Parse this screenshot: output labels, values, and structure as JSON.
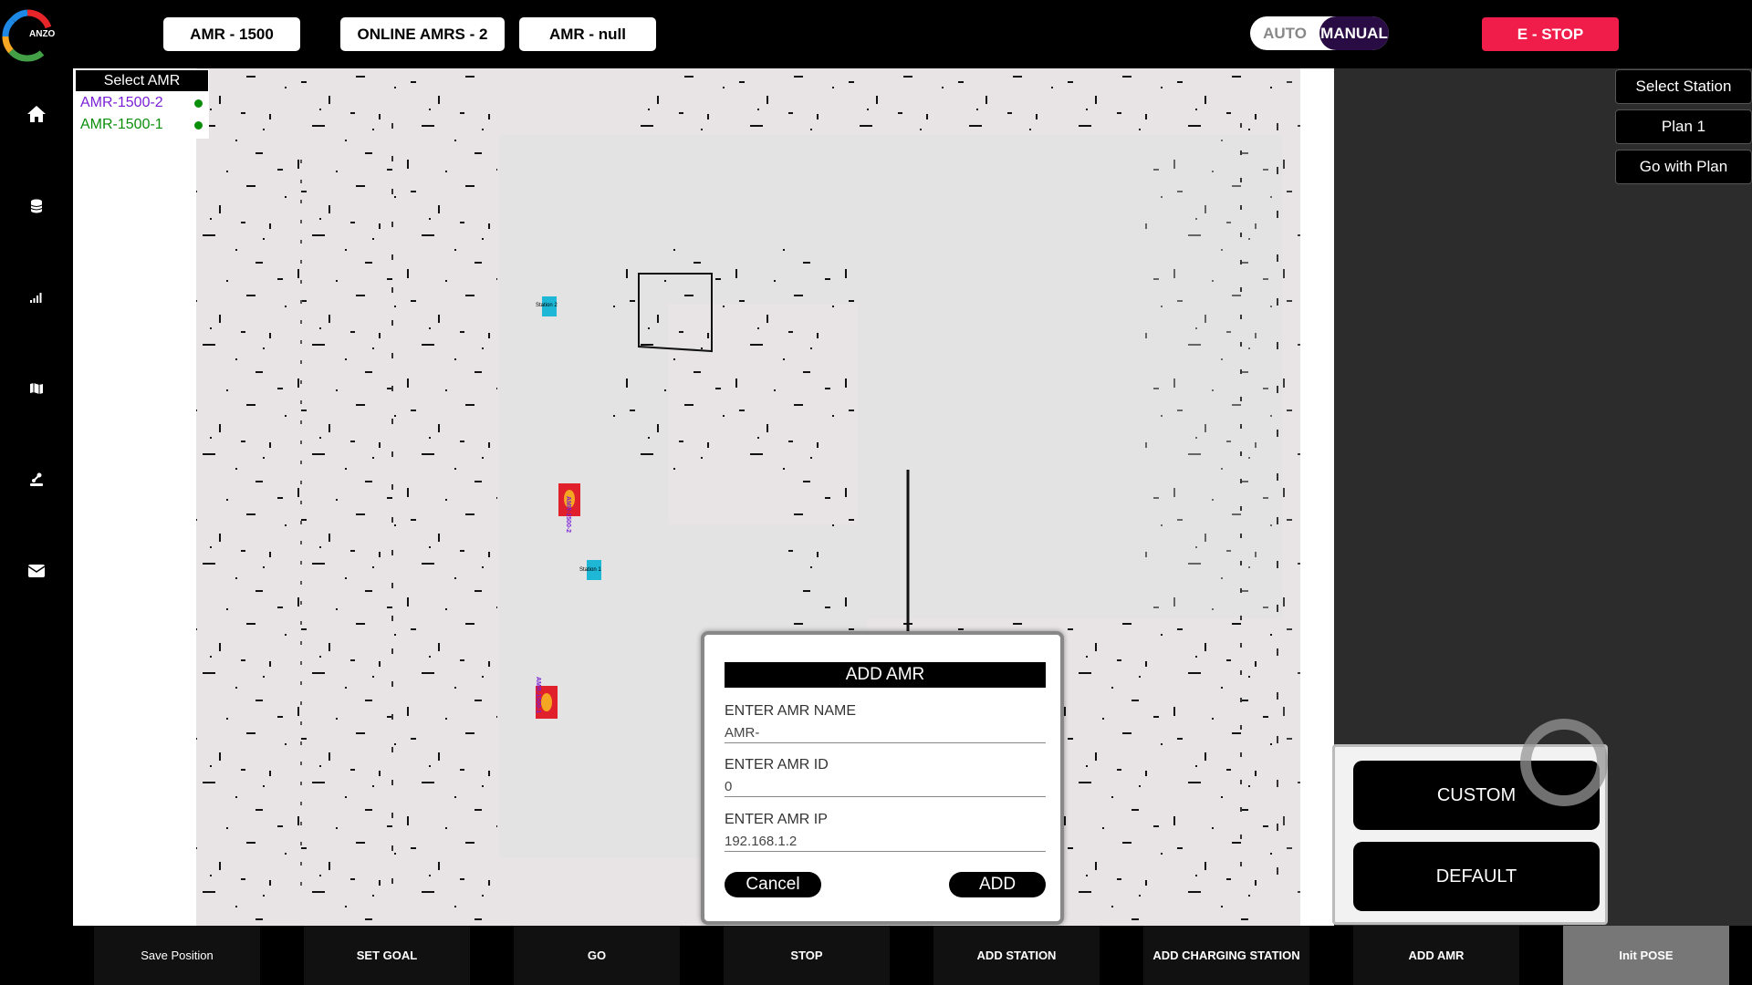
{
  "logo": {
    "text": "ANZO"
  },
  "top_bar": {
    "amr_model": "AMR - 1500",
    "online_amrs": "ONLINE AMRS - 2",
    "amr_selected": "AMR - null",
    "mode_auto": "AUTO",
    "mode_manual": "MANUAL",
    "mode_selected": "MANUAL",
    "estop": "E - STOP"
  },
  "sidebar": {
    "items": [
      {
        "icon": "home-icon"
      },
      {
        "icon": "database-icon"
      },
      {
        "icon": "signal-icon"
      },
      {
        "icon": "map-icon"
      },
      {
        "icon": "robot-arm-icon"
      },
      {
        "icon": "mail-icon"
      }
    ]
  },
  "amr_panel": {
    "title": "Select AMR",
    "items": [
      {
        "name": "AMR-1500-2",
        "color": "#7a1fd6",
        "status": "online"
      },
      {
        "name": "AMR-1500-1",
        "color": "#0a8f0a",
        "status": "online"
      }
    ]
  },
  "map": {
    "stations": [
      {
        "label": "Station 2"
      },
      {
        "label": "Station 1"
      }
    ],
    "robots": [
      {
        "label": "AMR-1500-2"
      },
      {
        "label": "AMR-1500-1"
      }
    ]
  },
  "right_panel": {
    "select_station": "Select Station",
    "plan": "Plan 1",
    "go_with_plan": "Go with Plan"
  },
  "pose_panel": {
    "custom": "CUSTOM",
    "default": "DEFAULT"
  },
  "modal": {
    "title": "ADD AMR",
    "name_label": "ENTER AMR NAME",
    "name_value": "AMR-",
    "id_label": "ENTER AMR ID",
    "id_value": "0",
    "ip_label": "ENTER AMR IP",
    "ip_value": "192.168.1.2",
    "cancel": "Cancel",
    "add": "ADD"
  },
  "bottom_bar": {
    "save_position": "Save Position",
    "set_goal": "SET GOAL",
    "go": "GO",
    "stop": "STOP",
    "add_station": "ADD STATION",
    "add_charging_station": "ADD CHARGING STATION",
    "add_amr": "ADD AMR",
    "init_pose": "Init POSE",
    "active": "init_pose"
  },
  "colors": {
    "estop": "#f01d4a",
    "manual_active": "#2a0c45",
    "station": "#1eb7d6",
    "robot": "#e0202a",
    "map_floor": "#e8e4e6"
  }
}
